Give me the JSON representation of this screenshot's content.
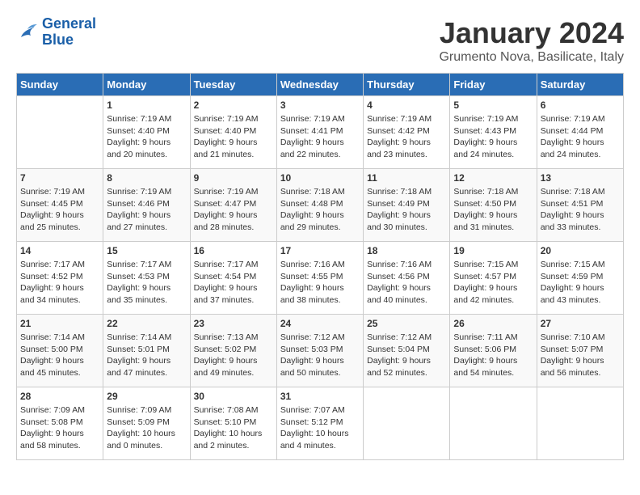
{
  "header": {
    "logo_line1": "General",
    "logo_line2": "Blue",
    "title": "January 2024",
    "subtitle": "Grumento Nova, Basilicate, Italy"
  },
  "days_of_week": [
    "Sunday",
    "Monday",
    "Tuesday",
    "Wednesday",
    "Thursday",
    "Friday",
    "Saturday"
  ],
  "weeks": [
    [
      {
        "num": "",
        "sunrise": "",
        "sunset": "",
        "daylight": ""
      },
      {
        "num": "1",
        "sunrise": "Sunrise: 7:19 AM",
        "sunset": "Sunset: 4:40 PM",
        "daylight": "Daylight: 9 hours and 20 minutes."
      },
      {
        "num": "2",
        "sunrise": "Sunrise: 7:19 AM",
        "sunset": "Sunset: 4:40 PM",
        "daylight": "Daylight: 9 hours and 21 minutes."
      },
      {
        "num": "3",
        "sunrise": "Sunrise: 7:19 AM",
        "sunset": "Sunset: 4:41 PM",
        "daylight": "Daylight: 9 hours and 22 minutes."
      },
      {
        "num": "4",
        "sunrise": "Sunrise: 7:19 AM",
        "sunset": "Sunset: 4:42 PM",
        "daylight": "Daylight: 9 hours and 23 minutes."
      },
      {
        "num": "5",
        "sunrise": "Sunrise: 7:19 AM",
        "sunset": "Sunset: 4:43 PM",
        "daylight": "Daylight: 9 hours and 24 minutes."
      },
      {
        "num": "6",
        "sunrise": "Sunrise: 7:19 AM",
        "sunset": "Sunset: 4:44 PM",
        "daylight": "Daylight: 9 hours and 24 minutes."
      }
    ],
    [
      {
        "num": "7",
        "sunrise": "Sunrise: 7:19 AM",
        "sunset": "Sunset: 4:45 PM",
        "daylight": "Daylight: 9 hours and 25 minutes."
      },
      {
        "num": "8",
        "sunrise": "Sunrise: 7:19 AM",
        "sunset": "Sunset: 4:46 PM",
        "daylight": "Daylight: 9 hours and 27 minutes."
      },
      {
        "num": "9",
        "sunrise": "Sunrise: 7:19 AM",
        "sunset": "Sunset: 4:47 PM",
        "daylight": "Daylight: 9 hours and 28 minutes."
      },
      {
        "num": "10",
        "sunrise": "Sunrise: 7:18 AM",
        "sunset": "Sunset: 4:48 PM",
        "daylight": "Daylight: 9 hours and 29 minutes."
      },
      {
        "num": "11",
        "sunrise": "Sunrise: 7:18 AM",
        "sunset": "Sunset: 4:49 PM",
        "daylight": "Daylight: 9 hours and 30 minutes."
      },
      {
        "num": "12",
        "sunrise": "Sunrise: 7:18 AM",
        "sunset": "Sunset: 4:50 PM",
        "daylight": "Daylight: 9 hours and 31 minutes."
      },
      {
        "num": "13",
        "sunrise": "Sunrise: 7:18 AM",
        "sunset": "Sunset: 4:51 PM",
        "daylight": "Daylight: 9 hours and 33 minutes."
      }
    ],
    [
      {
        "num": "14",
        "sunrise": "Sunrise: 7:17 AM",
        "sunset": "Sunset: 4:52 PM",
        "daylight": "Daylight: 9 hours and 34 minutes."
      },
      {
        "num": "15",
        "sunrise": "Sunrise: 7:17 AM",
        "sunset": "Sunset: 4:53 PM",
        "daylight": "Daylight: 9 hours and 35 minutes."
      },
      {
        "num": "16",
        "sunrise": "Sunrise: 7:17 AM",
        "sunset": "Sunset: 4:54 PM",
        "daylight": "Daylight: 9 hours and 37 minutes."
      },
      {
        "num": "17",
        "sunrise": "Sunrise: 7:16 AM",
        "sunset": "Sunset: 4:55 PM",
        "daylight": "Daylight: 9 hours and 38 minutes."
      },
      {
        "num": "18",
        "sunrise": "Sunrise: 7:16 AM",
        "sunset": "Sunset: 4:56 PM",
        "daylight": "Daylight: 9 hours and 40 minutes."
      },
      {
        "num": "19",
        "sunrise": "Sunrise: 7:15 AM",
        "sunset": "Sunset: 4:57 PM",
        "daylight": "Daylight: 9 hours and 42 minutes."
      },
      {
        "num": "20",
        "sunrise": "Sunrise: 7:15 AM",
        "sunset": "Sunset: 4:59 PM",
        "daylight": "Daylight: 9 hours and 43 minutes."
      }
    ],
    [
      {
        "num": "21",
        "sunrise": "Sunrise: 7:14 AM",
        "sunset": "Sunset: 5:00 PM",
        "daylight": "Daylight: 9 hours and 45 minutes."
      },
      {
        "num": "22",
        "sunrise": "Sunrise: 7:14 AM",
        "sunset": "Sunset: 5:01 PM",
        "daylight": "Daylight: 9 hours and 47 minutes."
      },
      {
        "num": "23",
        "sunrise": "Sunrise: 7:13 AM",
        "sunset": "Sunset: 5:02 PM",
        "daylight": "Daylight: 9 hours and 49 minutes."
      },
      {
        "num": "24",
        "sunrise": "Sunrise: 7:12 AM",
        "sunset": "Sunset: 5:03 PM",
        "daylight": "Daylight: 9 hours and 50 minutes."
      },
      {
        "num": "25",
        "sunrise": "Sunrise: 7:12 AM",
        "sunset": "Sunset: 5:04 PM",
        "daylight": "Daylight: 9 hours and 52 minutes."
      },
      {
        "num": "26",
        "sunrise": "Sunrise: 7:11 AM",
        "sunset": "Sunset: 5:06 PM",
        "daylight": "Daylight: 9 hours and 54 minutes."
      },
      {
        "num": "27",
        "sunrise": "Sunrise: 7:10 AM",
        "sunset": "Sunset: 5:07 PM",
        "daylight": "Daylight: 9 hours and 56 minutes."
      }
    ],
    [
      {
        "num": "28",
        "sunrise": "Sunrise: 7:09 AM",
        "sunset": "Sunset: 5:08 PM",
        "daylight": "Daylight: 9 hours and 58 minutes."
      },
      {
        "num": "29",
        "sunrise": "Sunrise: 7:09 AM",
        "sunset": "Sunset: 5:09 PM",
        "daylight": "Daylight: 10 hours and 0 minutes."
      },
      {
        "num": "30",
        "sunrise": "Sunrise: 7:08 AM",
        "sunset": "Sunset: 5:10 PM",
        "daylight": "Daylight: 10 hours and 2 minutes."
      },
      {
        "num": "31",
        "sunrise": "Sunrise: 7:07 AM",
        "sunset": "Sunset: 5:12 PM",
        "daylight": "Daylight: 10 hours and 4 minutes."
      },
      {
        "num": "",
        "sunrise": "",
        "sunset": "",
        "daylight": ""
      },
      {
        "num": "",
        "sunrise": "",
        "sunset": "",
        "daylight": ""
      },
      {
        "num": "",
        "sunrise": "",
        "sunset": "",
        "daylight": ""
      }
    ]
  ]
}
